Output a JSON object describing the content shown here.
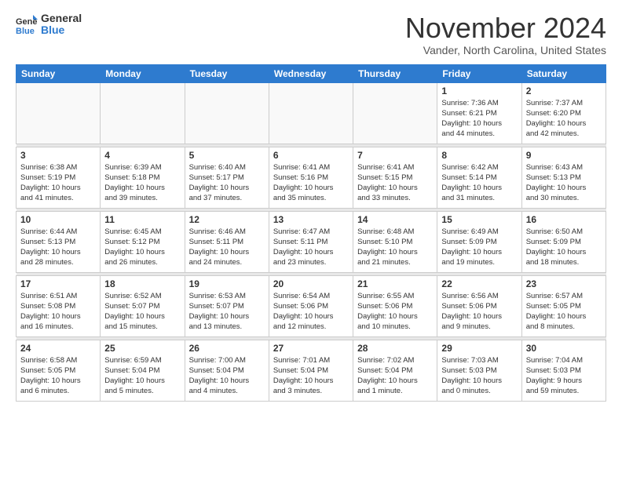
{
  "logo": {
    "general": "General",
    "blue": "Blue"
  },
  "title": "November 2024",
  "location": "Vander, North Carolina, United States",
  "headers": [
    "Sunday",
    "Monday",
    "Tuesday",
    "Wednesday",
    "Thursday",
    "Friday",
    "Saturday"
  ],
  "weeks": [
    [
      {
        "day": "",
        "info": ""
      },
      {
        "day": "",
        "info": ""
      },
      {
        "day": "",
        "info": ""
      },
      {
        "day": "",
        "info": ""
      },
      {
        "day": "",
        "info": ""
      },
      {
        "day": "1",
        "info": "Sunrise: 7:36 AM\nSunset: 6:21 PM\nDaylight: 10 hours\nand 44 minutes."
      },
      {
        "day": "2",
        "info": "Sunrise: 7:37 AM\nSunset: 6:20 PM\nDaylight: 10 hours\nand 42 minutes."
      }
    ],
    [
      {
        "day": "3",
        "info": "Sunrise: 6:38 AM\nSunset: 5:19 PM\nDaylight: 10 hours\nand 41 minutes."
      },
      {
        "day": "4",
        "info": "Sunrise: 6:39 AM\nSunset: 5:18 PM\nDaylight: 10 hours\nand 39 minutes."
      },
      {
        "day": "5",
        "info": "Sunrise: 6:40 AM\nSunset: 5:17 PM\nDaylight: 10 hours\nand 37 minutes."
      },
      {
        "day": "6",
        "info": "Sunrise: 6:41 AM\nSunset: 5:16 PM\nDaylight: 10 hours\nand 35 minutes."
      },
      {
        "day": "7",
        "info": "Sunrise: 6:41 AM\nSunset: 5:15 PM\nDaylight: 10 hours\nand 33 minutes."
      },
      {
        "day": "8",
        "info": "Sunrise: 6:42 AM\nSunset: 5:14 PM\nDaylight: 10 hours\nand 31 minutes."
      },
      {
        "day": "9",
        "info": "Sunrise: 6:43 AM\nSunset: 5:13 PM\nDaylight: 10 hours\nand 30 minutes."
      }
    ],
    [
      {
        "day": "10",
        "info": "Sunrise: 6:44 AM\nSunset: 5:13 PM\nDaylight: 10 hours\nand 28 minutes."
      },
      {
        "day": "11",
        "info": "Sunrise: 6:45 AM\nSunset: 5:12 PM\nDaylight: 10 hours\nand 26 minutes."
      },
      {
        "day": "12",
        "info": "Sunrise: 6:46 AM\nSunset: 5:11 PM\nDaylight: 10 hours\nand 24 minutes."
      },
      {
        "day": "13",
        "info": "Sunrise: 6:47 AM\nSunset: 5:11 PM\nDaylight: 10 hours\nand 23 minutes."
      },
      {
        "day": "14",
        "info": "Sunrise: 6:48 AM\nSunset: 5:10 PM\nDaylight: 10 hours\nand 21 minutes."
      },
      {
        "day": "15",
        "info": "Sunrise: 6:49 AM\nSunset: 5:09 PM\nDaylight: 10 hours\nand 19 minutes."
      },
      {
        "day": "16",
        "info": "Sunrise: 6:50 AM\nSunset: 5:09 PM\nDaylight: 10 hours\nand 18 minutes."
      }
    ],
    [
      {
        "day": "17",
        "info": "Sunrise: 6:51 AM\nSunset: 5:08 PM\nDaylight: 10 hours\nand 16 minutes."
      },
      {
        "day": "18",
        "info": "Sunrise: 6:52 AM\nSunset: 5:07 PM\nDaylight: 10 hours\nand 15 minutes."
      },
      {
        "day": "19",
        "info": "Sunrise: 6:53 AM\nSunset: 5:07 PM\nDaylight: 10 hours\nand 13 minutes."
      },
      {
        "day": "20",
        "info": "Sunrise: 6:54 AM\nSunset: 5:06 PM\nDaylight: 10 hours\nand 12 minutes."
      },
      {
        "day": "21",
        "info": "Sunrise: 6:55 AM\nSunset: 5:06 PM\nDaylight: 10 hours\nand 10 minutes."
      },
      {
        "day": "22",
        "info": "Sunrise: 6:56 AM\nSunset: 5:06 PM\nDaylight: 10 hours\nand 9 minutes."
      },
      {
        "day": "23",
        "info": "Sunrise: 6:57 AM\nSunset: 5:05 PM\nDaylight: 10 hours\nand 8 minutes."
      }
    ],
    [
      {
        "day": "24",
        "info": "Sunrise: 6:58 AM\nSunset: 5:05 PM\nDaylight: 10 hours\nand 6 minutes."
      },
      {
        "day": "25",
        "info": "Sunrise: 6:59 AM\nSunset: 5:04 PM\nDaylight: 10 hours\nand 5 minutes."
      },
      {
        "day": "26",
        "info": "Sunrise: 7:00 AM\nSunset: 5:04 PM\nDaylight: 10 hours\nand 4 minutes."
      },
      {
        "day": "27",
        "info": "Sunrise: 7:01 AM\nSunset: 5:04 PM\nDaylight: 10 hours\nand 3 minutes."
      },
      {
        "day": "28",
        "info": "Sunrise: 7:02 AM\nSunset: 5:04 PM\nDaylight: 10 hours\nand 1 minute."
      },
      {
        "day": "29",
        "info": "Sunrise: 7:03 AM\nSunset: 5:03 PM\nDaylight: 10 hours\nand 0 minutes."
      },
      {
        "day": "30",
        "info": "Sunrise: 7:04 AM\nSunset: 5:03 PM\nDaylight: 9 hours\nand 59 minutes."
      }
    ]
  ]
}
